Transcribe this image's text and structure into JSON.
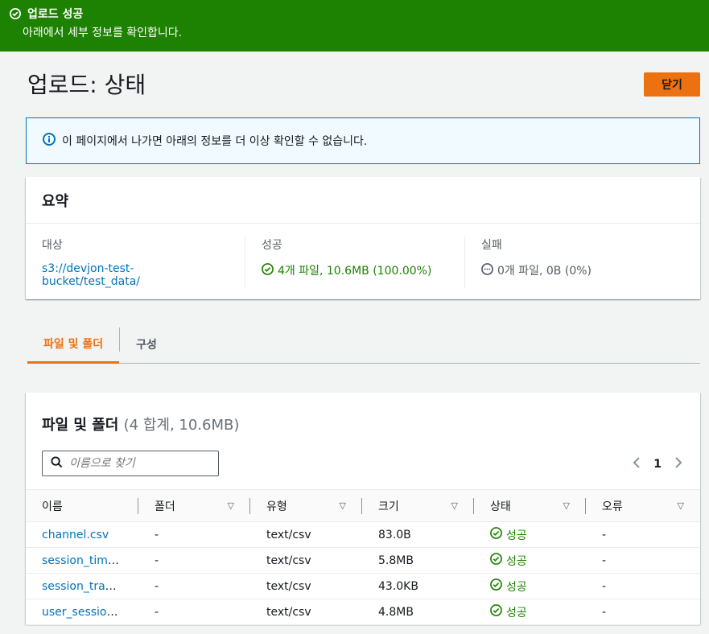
{
  "flash": {
    "title": "업로드 성공",
    "message": "아래에서 세부 정보를 확인합니다."
  },
  "page": {
    "title": "업로드: 상태",
    "close_label": "닫기"
  },
  "info": {
    "text": "이 페이지에서 나가면 아래의 정보를 더 이상 확인할 수 없습니다."
  },
  "summary": {
    "title": "요약",
    "target_label": "대상",
    "target_value": "s3://devjon-test-bucket/test_data/",
    "success_label": "성공",
    "success_value": "4개 파일, 10.6MB (100.00%)",
    "fail_label": "실패",
    "fail_value": "0개 파일, 0B (0%)"
  },
  "tabs": [
    {
      "label": "파일 및 폴더"
    },
    {
      "label": "구성"
    }
  ],
  "files": {
    "title": "파일 및 폴더",
    "count": "(4 합계, 10.6MB)",
    "search_placeholder": "이름으로 찾기",
    "page": "1",
    "columns": [
      "이름",
      "폴더",
      "유형",
      "크기",
      "상태",
      "오류"
    ],
    "rows": [
      {
        "name": "channel.csv",
        "folder": "-",
        "type": "text/csv",
        "size": "83.0B",
        "status": "성공",
        "error": "-"
      },
      {
        "name": "session_time…",
        "folder": "-",
        "type": "text/csv",
        "size": "5.8MB",
        "status": "성공",
        "error": "-"
      },
      {
        "name": "session_trans…",
        "folder": "-",
        "type": "text/csv",
        "size": "43.0KB",
        "status": "성공",
        "error": "-"
      },
      {
        "name": "user_session…",
        "folder": "-",
        "type": "text/csv",
        "size": "4.8MB",
        "status": "성공",
        "error": "-"
      }
    ]
  },
  "colors": {
    "flash_bg": "#1d8102",
    "accent": "#ec7211",
    "link": "#0073bb",
    "success": "#1d8102"
  }
}
